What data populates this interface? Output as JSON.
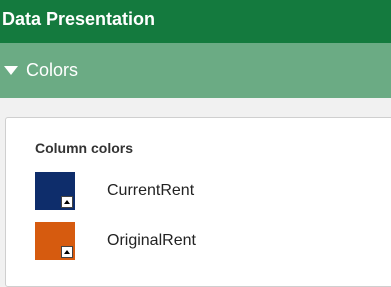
{
  "header": {
    "title": "Data Presentation"
  },
  "section": {
    "label": "Colors",
    "icon": "triangle-down-icon"
  },
  "panel": {
    "title": "Column colors",
    "items": [
      {
        "label": "CurrentRent",
        "color": "#0e2d6b"
      },
      {
        "label": "OriginalRent",
        "color": "#d65b0f"
      }
    ]
  }
}
